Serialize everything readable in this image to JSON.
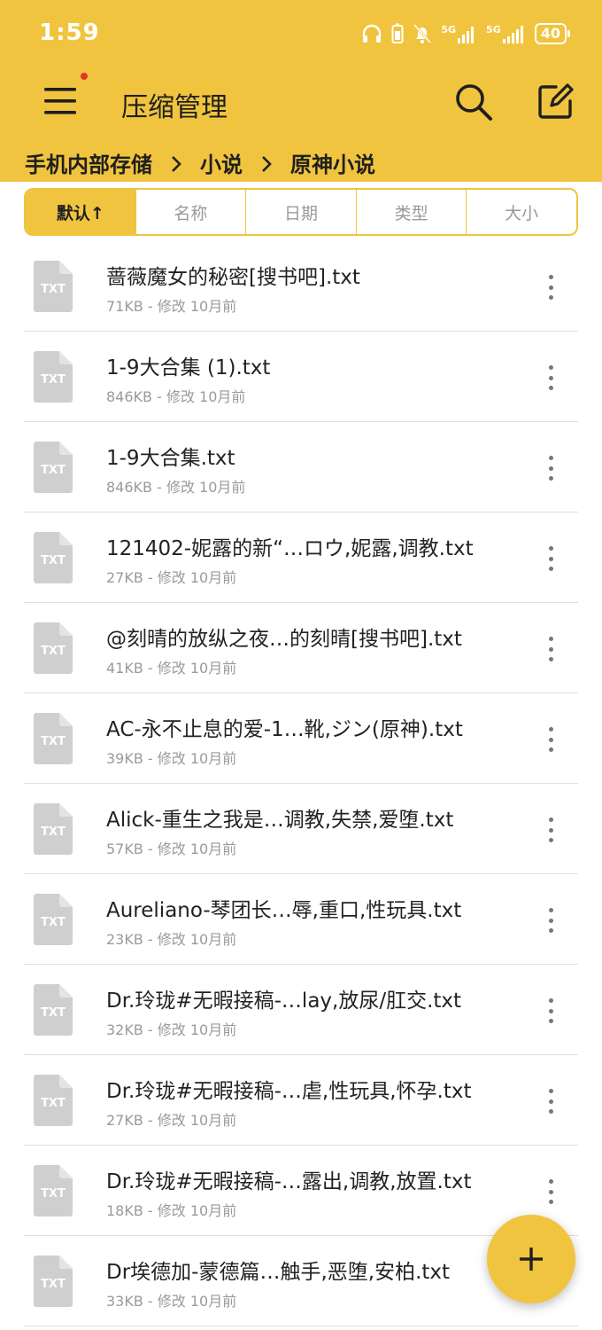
{
  "status_bar": {
    "time": "1:59",
    "battery": "40",
    "signal_1": "5G",
    "signal_2": "5G"
  },
  "header": {
    "title": "压缩管理",
    "icons": {
      "menu": "hamburger-menu-icon",
      "search": "search-icon",
      "edit": "edit-icon"
    }
  },
  "breadcrumb": {
    "items": [
      "手机内部存储",
      "小说",
      "原神小说"
    ]
  },
  "sort_tabs": [
    "默认↑",
    "名称",
    "日期",
    "类型",
    "大小"
  ],
  "files": [
    {
      "icon_label": "TXT",
      "name": " 蔷薇魔女的秘密[搜书吧].txt",
      "meta": "71KB - 修改 10月前"
    },
    {
      "icon_label": "TXT",
      "name": "1-9大合集 (1).txt",
      "meta": "846KB - 修改 10月前"
    },
    {
      "icon_label": "TXT",
      "name": "1-9大合集.txt",
      "meta": "846KB - 修改 10月前"
    },
    {
      "icon_label": "TXT",
      "name": "121402-妮露的新“…ロウ,妮露,调教.txt",
      "meta": "27KB - 修改 10月前"
    },
    {
      "icon_label": "TXT",
      "name": "@刻晴的放纵之夜…的刻晴[搜书吧].txt",
      "meta": "41KB - 修改 10月前"
    },
    {
      "icon_label": "TXT",
      "name": "AC-永不止息的爱-1…靴,ジン(原神).txt",
      "meta": "39KB - 修改 10月前"
    },
    {
      "icon_label": "TXT",
      "name": "Alick-重生之我是…调教,失禁,爱堕.txt",
      "meta": "57KB - 修改 10月前"
    },
    {
      "icon_label": "TXT",
      "name": "Aureliano-琴团长…辱,重口,性玩具.txt",
      "meta": "23KB - 修改 10月前"
    },
    {
      "icon_label": "TXT",
      "name": "Dr.玲珑#无暇接稿-…lay,放尿/肛交.txt",
      "meta": "32KB - 修改 10月前"
    },
    {
      "icon_label": "TXT",
      "name": "Dr.玲珑#无暇接稿-…虐,性玩具,怀孕.txt",
      "meta": "27KB - 修改 10月前"
    },
    {
      "icon_label": "TXT",
      "name": "Dr.玲珑#无暇接稿-…露出,调教,放置.txt",
      "meta": "18KB - 修改 10月前"
    },
    {
      "icon_label": "TXT",
      "name": "Dr埃德加-蒙德篇…触手,恶堕,安柏.txt",
      "meta": "33KB - 修改 10月前"
    }
  ],
  "fab": {
    "icon": "plus-icon"
  },
  "colors": {
    "accent": "#f1c43f",
    "text": "#222222",
    "meta": "#9a9a9a",
    "file_icon": "#cfcfcf"
  }
}
